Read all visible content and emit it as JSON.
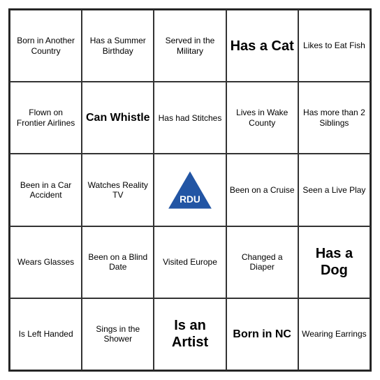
{
  "board": {
    "cells": [
      {
        "id": "r0c0",
        "text": "Born in Another Country",
        "style": "normal"
      },
      {
        "id": "r0c1",
        "text": "Has a Summer Birthday",
        "style": "normal"
      },
      {
        "id": "r0c2",
        "text": "Served in the Military",
        "style": "normal"
      },
      {
        "id": "r0c3",
        "text": "Has a Cat",
        "style": "large-text"
      },
      {
        "id": "r0c4",
        "text": "Likes to Eat Fish",
        "style": "normal"
      },
      {
        "id": "r1c0",
        "text": "Flown on Frontier Airlines",
        "style": "normal"
      },
      {
        "id": "r1c1",
        "text": "Can Whistle",
        "style": "medium-large"
      },
      {
        "id": "r1c2",
        "text": "Has had Stitches",
        "style": "normal"
      },
      {
        "id": "r1c3",
        "text": "Lives in Wake County",
        "style": "normal"
      },
      {
        "id": "r1c4",
        "text": "Has more than 2 Siblings",
        "style": "normal"
      },
      {
        "id": "r2c0",
        "text": "Been in a Car Accident",
        "style": "normal"
      },
      {
        "id": "r2c1",
        "text": "Watches Reality TV",
        "style": "normal"
      },
      {
        "id": "r2c2",
        "text": "RDU_LOGO",
        "style": "rdu"
      },
      {
        "id": "r2c3",
        "text": "Been on a Cruise",
        "style": "normal"
      },
      {
        "id": "r2c4",
        "text": "Seen a Live Play",
        "style": "normal"
      },
      {
        "id": "r3c0",
        "text": "Wears Glasses",
        "style": "normal"
      },
      {
        "id": "r3c1",
        "text": "Been on a Blind Date",
        "style": "normal"
      },
      {
        "id": "r3c2",
        "text": "Visited Europe",
        "style": "normal"
      },
      {
        "id": "r3c3",
        "text": "Changed a Diaper",
        "style": "normal"
      },
      {
        "id": "r3c4",
        "text": "Has a Dog",
        "style": "large-text"
      },
      {
        "id": "r4c0",
        "text": "Is Left Handed",
        "style": "normal"
      },
      {
        "id": "r4c1",
        "text": "Sings in the Shower",
        "style": "normal"
      },
      {
        "id": "r4c2",
        "text": "Is an Artist",
        "style": "large-text"
      },
      {
        "id": "r4c3",
        "text": "Born in NC",
        "style": "medium-large"
      },
      {
        "id": "r4c4",
        "text": "Wearing Earrings",
        "style": "normal"
      }
    ]
  }
}
